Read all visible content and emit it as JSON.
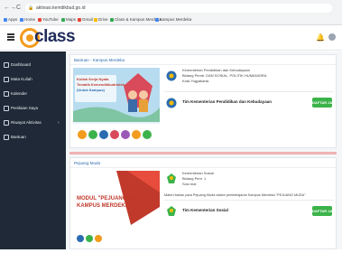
{
  "browser": {
    "url": "aktivasi.kemdikbud.go.id",
    "back": "←",
    "forward": "→",
    "reload": "C",
    "bookmarks": [
      "Apps",
      "Home",
      "YouTube",
      "Maps",
      "Gmail",
      "Drive",
      "Class & Kampus Merdeka",
      "Kampus Merdeka"
    ],
    "bookmark_colors": [
      "#4285f4",
      "#4285f4",
      "#ea4335",
      "#34a853",
      "#ea4335",
      "#fbbc04",
      "#34a853",
      "#4285f4"
    ]
  },
  "header": {
    "logo_text": "class",
    "bell_icon": "bell-icon"
  },
  "sidebar": {
    "items": [
      {
        "label": "Dashboard",
        "icon": "dashboard-icon"
      },
      {
        "label": "Mata Kuliah",
        "icon": "book-icon"
      },
      {
        "label": "Kalender",
        "icon": "calendar-icon"
      },
      {
        "label": "Penilaian Saya",
        "icon": "grade-icon"
      },
      {
        "label": "Riwayat Aktivitas",
        "icon": "history-icon"
      },
      {
        "label": "Bantuan",
        "icon": "help-icon"
      }
    ]
  },
  "cards": [
    {
      "title": "Bantuan - Kampus Merdeka",
      "banner_line1": "Kuliah Kerja Nyata",
      "banner_line2": "Tematik Kemendikbudristek",
      "banner_line3": "(Untuk Kampus)",
      "org_name": "Kementerian Pendidikan dan Kebudayaan",
      "org_sub1": "Bidang Pemb. DAN SOSIAL, POLITIK HUMANIORA",
      "org_sub2": "Kota Yogyakarta",
      "team_name": "Tim Kementerian Pendidikan dan Kebudayaan",
      "button": "DAFTAR JAM"
    },
    {
      "title": "Pejuang Muda",
      "banner_line1": "MODUL \"PEJUANG MUDA\"",
      "banner_line2": "KAMPUS MERDEKA",
      "org_name": "Kementerian Sosial",
      "org_sub1": "Bidang Pem. 1",
      "org_sub2": "Sosi mal",
      "desc": "Materi bahan para Pejuang Muda dalam pembelajaran Kampus Merdeka \"PEJUANG MUDA\"",
      "team_name": "Tim Kementerian Sosial",
      "button": "DAFTAR JAM"
    }
  ],
  "colors": {
    "accent": "#2b6cb0",
    "sidebar": "#1f2937",
    "button": "#3bb34a",
    "logo": "#f29b1d"
  }
}
